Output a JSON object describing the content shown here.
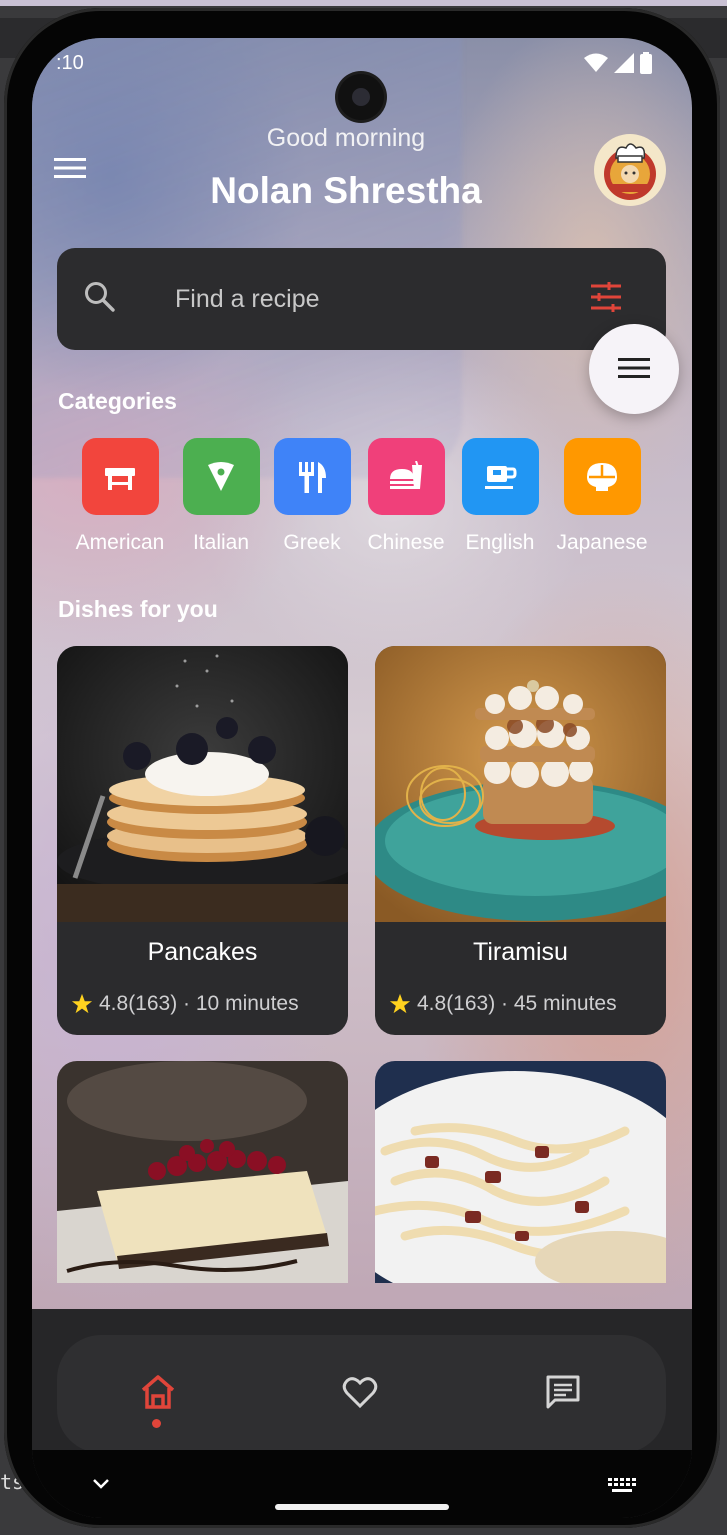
{
  "status_bar": {
    "time": ":10"
  },
  "header": {
    "greeting": "Good morning",
    "user_name": "Nolan Shrestha"
  },
  "search": {
    "placeholder": "Find a recipe"
  },
  "categories_title": "Categories",
  "categories": [
    {
      "label": "American",
      "color": "#f2453d",
      "icon": "diner-table-icon"
    },
    {
      "label": "Italian",
      "color": "#4caf50",
      "icon": "pizza-slice-icon"
    },
    {
      "label": "Greek",
      "color": "#3f83f8",
      "icon": "fork-knife-icon"
    },
    {
      "label": "Chinese",
      "color": "#f0407a",
      "icon": "takeout-icon"
    },
    {
      "label": "English",
      "color": "#2196f3",
      "icon": "teacup-icon"
    },
    {
      "label": "Japanese",
      "color": "#ff9800",
      "icon": "rice-bowl-icon"
    }
  ],
  "dishes_title": "Dishes for you",
  "dishes": [
    {
      "name": "Pancakes",
      "rating": "4.8(163) · 10 minutes"
    },
    {
      "name": "Tiramisu",
      "rating": "4.8(163) · 45 minutes"
    }
  ],
  "nav": {
    "items": [
      "home-icon",
      "heart-icon",
      "chat-icon"
    ],
    "active": "home",
    "accent_color": "#e0453a"
  }
}
